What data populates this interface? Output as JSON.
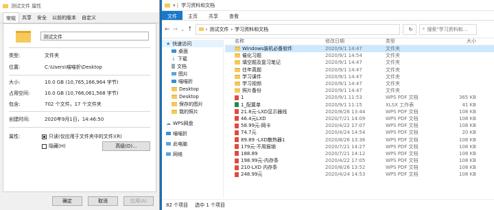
{
  "props": {
    "title": "测试文件 属性",
    "tabs": [
      "常规",
      "共享",
      "安全",
      "以前的版本",
      "自定义"
    ],
    "name_value": "测试文件",
    "rows": [
      {
        "k": "类型:",
        "v": "文件夹"
      },
      {
        "k": "位置:",
        "v": "C:\\Users\\喵喵折\\Desktop"
      },
      {
        "k": "大小:",
        "v": "10.0 GB (10,765,166,964 字节)"
      },
      {
        "k": "占用空间:",
        "v": "10.0 GB (10,766,061,568 字节)"
      },
      {
        "k": "包含:",
        "v": "702 个文件，17 个文件夹"
      },
      {
        "k": "创建时间:",
        "v": "2020年9月1日，14:46:50"
      },
      {
        "k": "属性:",
        "v": ""
      }
    ],
    "readonly_label": "只读(仅应用于文件夹中的文件)(R)",
    "hidden_label": "隐藏(H)",
    "advanced_label": "高级(D)...",
    "ok_label": "确定",
    "cancel_label": "取消",
    "apply_label": "应用(A)"
  },
  "explorer": {
    "title": "学习资料和文档",
    "ribbon_tabs": [
      "文件",
      "主页",
      "共享",
      "查看"
    ],
    "breadcrumb": [
      "测试文件",
      "学习资料和文档"
    ],
    "search_placeholder": "搜索\"学习资料和...",
    "nav_items": [
      {
        "label": "快速访问",
        "icon": "star-icon"
      },
      {
        "label": "桌面",
        "icon": "desktop-icon"
      },
      {
        "label": "下载",
        "icon": "download-icon"
      },
      {
        "label": "文档",
        "icon": "document-icon"
      },
      {
        "label": "图片",
        "icon": "picture-icon"
      },
      {
        "label": "喵喵折",
        "icon": "user-icon"
      },
      {
        "label": "Desktop",
        "icon": "folder-icon"
      },
      {
        "label": "Desktop",
        "icon": "folder-icon"
      },
      {
        "label": "保存的图片",
        "icon": "folder-icon"
      },
      {
        "label": "我的照片",
        "icon": "folder-icon"
      },
      {
        "label": "WPS网盘",
        "icon": "cloud-icon"
      },
      {
        "label": "喵喵折",
        "icon": "user-icon"
      },
      {
        "label": "此电脑",
        "icon": "computer-icon"
      },
      {
        "label": "网络",
        "icon": "network-icon"
      }
    ],
    "columns": [
      "名称",
      "修改日期",
      "类型",
      "大小"
    ],
    "files": [
      {
        "name": "Windows装机必备软件",
        "date": "2020/9/1 14:47",
        "type": "文件夹",
        "size": "",
        "kind": "folder"
      },
      {
        "name": "催化习题",
        "date": "2020/9/1 14:54",
        "type": "文件夹",
        "size": "",
        "kind": "folder"
      },
      {
        "name": "填空题及复习笔记",
        "date": "2020/9/1 14:47",
        "type": "文件夹",
        "size": "",
        "kind": "folder"
      },
      {
        "name": "往年真题",
        "date": "2020/9/1 14:47",
        "type": "文件夹",
        "size": "",
        "kind": "folder"
      },
      {
        "name": "学习课件",
        "date": "2020/9/1 14:47",
        "type": "文件夹",
        "size": "",
        "kind": "folder"
      },
      {
        "name": "学习视频",
        "date": "2020/9/1 14:47",
        "type": "文件夹",
        "size": "",
        "kind": "folder"
      },
      {
        "name": "照片备份",
        "date": "2020/9/1 14:47",
        "type": "文件夹",
        "size": "",
        "kind": "folder"
      },
      {
        "name": "1",
        "date": "2020/9/1 11:53",
        "type": "WPS PDF 文档",
        "size": "365 KB",
        "kind": "pdf"
      },
      {
        "name": "1_配置单",
        "date": "2020/9/1 11:15",
        "type": "XLSX 工作表",
        "size": "41 KB",
        "kind": "xlsx"
      },
      {
        "name": "21.8元-LXD显示器线",
        "date": "2020/8/26 13:44",
        "type": "WPS PDF 文档",
        "size": "108 KB",
        "kind": "pdf"
      },
      {
        "name": "46.4元LXD",
        "date": "2020/7/21 14:09",
        "type": "WPS PDF 文档",
        "size": "108 KB",
        "kind": "pdf"
      },
      {
        "name": "58.99元-网卡",
        "date": "2020/4/22 17:07",
        "type": "WPS PDF 文档",
        "size": "108 KB",
        "kind": "pdf"
      },
      {
        "name": "74.7元",
        "date": "2020/4/24 14:54",
        "type": "WPS PDF 文档",
        "size": "20 KB",
        "kind": "pdf"
      },
      {
        "name": "89.89 -LXD散热器1",
        "date": "2020/8/26 13:36",
        "type": "WPS PDF 文档",
        "size": "108 KB",
        "kind": "pdf"
      },
      {
        "name": "179元-不用报销",
        "date": "2020/7/21 14:27",
        "type": "WPS PDF 文档",
        "size": "108 KB",
        "kind": "pdf"
      },
      {
        "name": "188.89",
        "date": "2020/7/21 14:12",
        "type": "WPS PDF 文档",
        "size": "108 KB",
        "kind": "pdf"
      },
      {
        "name": "198.99元-内存条",
        "date": "2020/4/22 17:05",
        "type": "WPS PDF 文档",
        "size": "108 KB",
        "kind": "pdf"
      },
      {
        "name": "210-LXD 内存条",
        "date": "2020/8/26 13:52",
        "type": "WPS PDF 文档",
        "size": "108 KB",
        "kind": "pdf"
      },
      {
        "name": "248.99元",
        "date": "2020/4/24 14:53",
        "type": "WPS PDF 文档",
        "size": "108 KB",
        "kind": "pdf"
      }
    ],
    "status_count": "82 个项目",
    "status_selected": "选中 1 个项目"
  }
}
